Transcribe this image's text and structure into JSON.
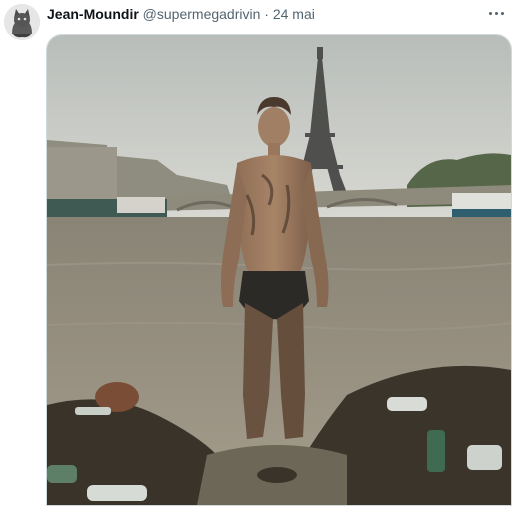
{
  "tweet": {
    "author_name": "Jean-Moundir",
    "author_handle": "@supermegadrivin",
    "separator": "·",
    "date": "24 mai"
  },
  "icons": {
    "avatar": "cat-avatar",
    "more": "more-horizontal-icon"
  },
  "colors": {
    "text_primary": "#0f1419",
    "text_secondary": "#536471",
    "border": "#cfd9de"
  }
}
